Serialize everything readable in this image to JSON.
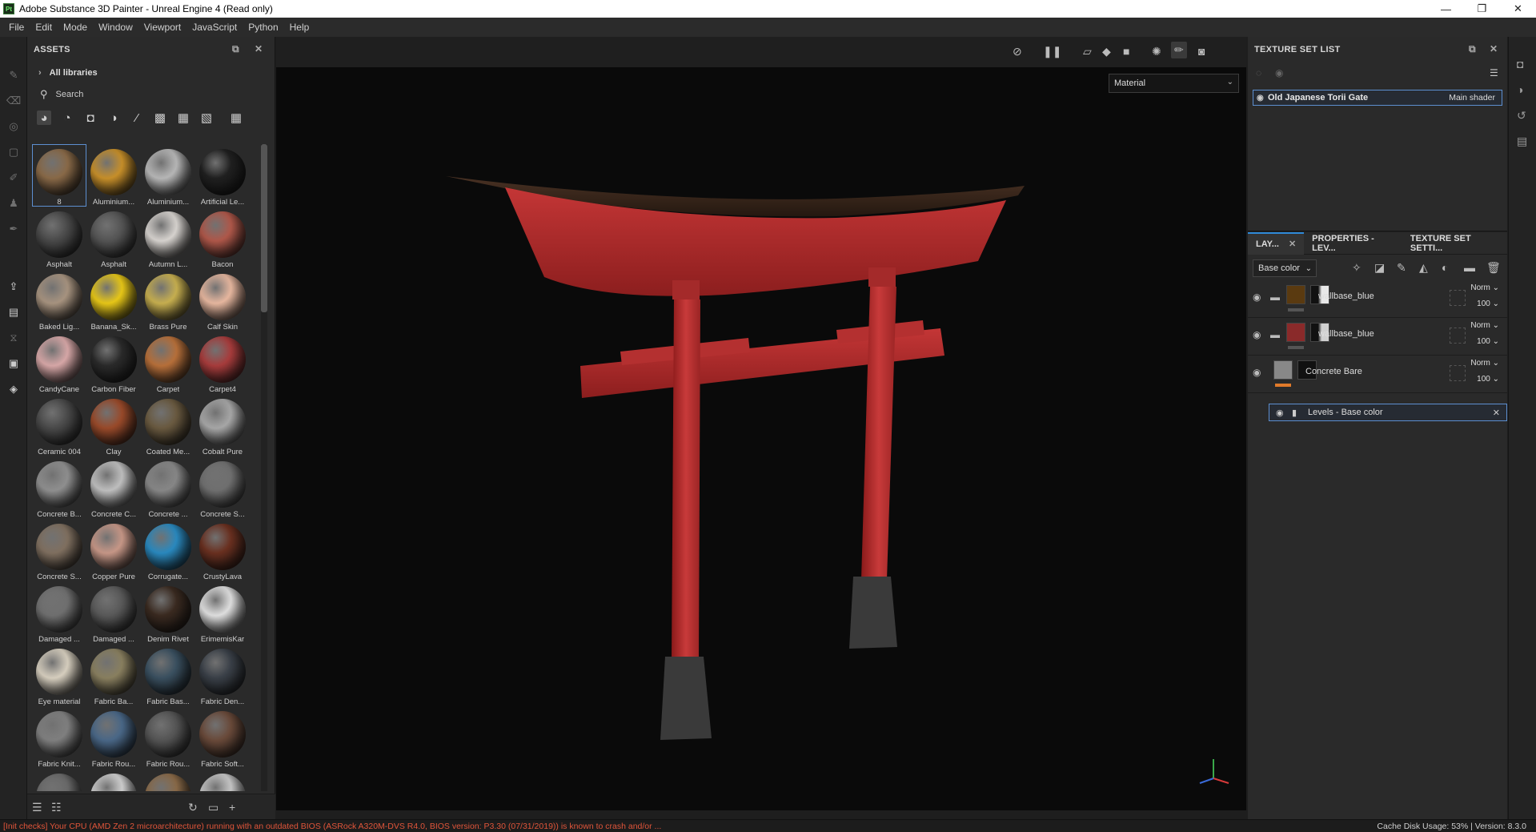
{
  "window": {
    "title": "Adobe Substance 3D Painter - Unreal Engine 4 (Read only)",
    "app_badge": "Pt",
    "minimize": "—",
    "maximize": "❐",
    "close": "✕"
  },
  "menu": [
    "File",
    "Edit",
    "Mode",
    "Window",
    "Viewport",
    "JavaScript",
    "Python",
    "Help"
  ],
  "assets": {
    "title": "ASSETS",
    "library": "All libraries",
    "search_placeholder": "Search",
    "items": [
      {
        "label": "8",
        "color": "#8a6a48"
      },
      {
        "label": "Aluminium...",
        "color": "#c8902a"
      },
      {
        "label": "Aluminium...",
        "color": "#b8b8b8"
      },
      {
        "label": "Artificial Le...",
        "color": "#202020"
      },
      {
        "label": "Asphalt",
        "color": "#4a4a4a"
      },
      {
        "label": "Asphalt",
        "color": "#555555"
      },
      {
        "label": "Autumn L...",
        "color": "#d8d4d0"
      },
      {
        "label": "Bacon",
        "color": "#b0584a"
      },
      {
        "label": "Baked Lig...",
        "color": "#a89480"
      },
      {
        "label": "Banana_Sk...",
        "color": "#e8c818"
      },
      {
        "label": "Brass Pure",
        "color": "#c8b050"
      },
      {
        "label": "Calf Skin",
        "color": "#e8b8a0"
      },
      {
        "label": "CandyCane",
        "color": "#d8a8a8"
      },
      {
        "label": "Carbon Fiber",
        "color": "#2a2a2a"
      },
      {
        "label": "Carpet",
        "color": "#b8703a"
      },
      {
        "label": "Carpet4",
        "color": "#a83c3c"
      },
      {
        "label": "Ceramic 004",
        "color": "#4a4a4a"
      },
      {
        "label": "Clay",
        "color": "#9a4a2a"
      },
      {
        "label": "Coated Me...",
        "color": "#6a5a40"
      },
      {
        "label": "Cobalt Pure",
        "color": "#a8a8a8"
      },
      {
        "label": "Concrete B...",
        "color": "#909090"
      },
      {
        "label": "Concrete C...",
        "color": "#c0c0c0"
      },
      {
        "label": "Concrete ...",
        "color": "#888888"
      },
      {
        "label": "Concrete S...",
        "color": "#707070"
      },
      {
        "label": "Concrete S...",
        "color": "#807060"
      },
      {
        "label": "Copper Pure",
        "color": "#c89888"
      },
      {
        "label": "Corrugate...",
        "color": "#2a8ac0"
      },
      {
        "label": "CrustyLava",
        "color": "#6a3020"
      },
      {
        "label": "Damaged ...",
        "color": "#707070"
      },
      {
        "label": "Damaged ...",
        "color": "#5a5a5a"
      },
      {
        "label": "Denim Rivet",
        "color": "#3a2a20"
      },
      {
        "label": "ErimemisKar",
        "color": "#e0e0e0"
      },
      {
        "label": "Eye material",
        "color": "#d8d0c0"
      },
      {
        "label": "Fabric Ba...",
        "color": "#8a8060"
      },
      {
        "label": "Fabric Bas...",
        "color": "#3a5060"
      },
      {
        "label": "Fabric Den...",
        "color": "#3a4048"
      },
      {
        "label": "Fabric Knit...",
        "color": "#808080"
      },
      {
        "label": "Fabric Rou...",
        "color": "#4a6888"
      },
      {
        "label": "Fabric Rou...",
        "color": "#555555"
      },
      {
        "label": "Fabric Soft...",
        "color": "#6a4a3a"
      },
      {
        "label": "",
        "color": "#6a6a6a"
      },
      {
        "label": "",
        "color": "#d0d0d0"
      },
      {
        "label": "",
        "color": "#8a6a48"
      },
      {
        "label": "",
        "color": "#c8c8c8"
      }
    ]
  },
  "viewport": {
    "display_mode": "Material"
  },
  "texture_set_list": {
    "title": "TEXTURE SET LIST",
    "set_name": "Old Japanese Torii Gate",
    "shader": "Main shader"
  },
  "layers_panel": {
    "tabs": [
      "LAY...",
      "PROPERTIES - LEV...",
      "TEXTURE SET SETTI..."
    ],
    "channel": "Base color",
    "layers": [
      {
        "name": "wallbase_blue",
        "blend": "Norm",
        "opacity": "100",
        "thumb": "#5a3a10",
        "mask": "#e8e8e8"
      },
      {
        "name": "wallbase_blue",
        "blend": "Norm",
        "opacity": "100",
        "thumb": "#8a2a2a",
        "mask": "#d0d0d0"
      },
      {
        "name": "Concrete Bare",
        "blend": "Norm",
        "opacity": "100",
        "thumb": "#888888",
        "mask": "#111111"
      }
    ],
    "effect": "Levels - Base color"
  },
  "status": {
    "warning": "[Init checks] Your CPU (AMD Zen 2 microarchitecture) running with an outdated BIOS (ASRock A320M-DVS R4.0, BIOS version: P3.30 (07/31/2019)) is known to crash and/or ...",
    "right": "Cache Disk Usage:   53% | Version: 8.3.0"
  }
}
